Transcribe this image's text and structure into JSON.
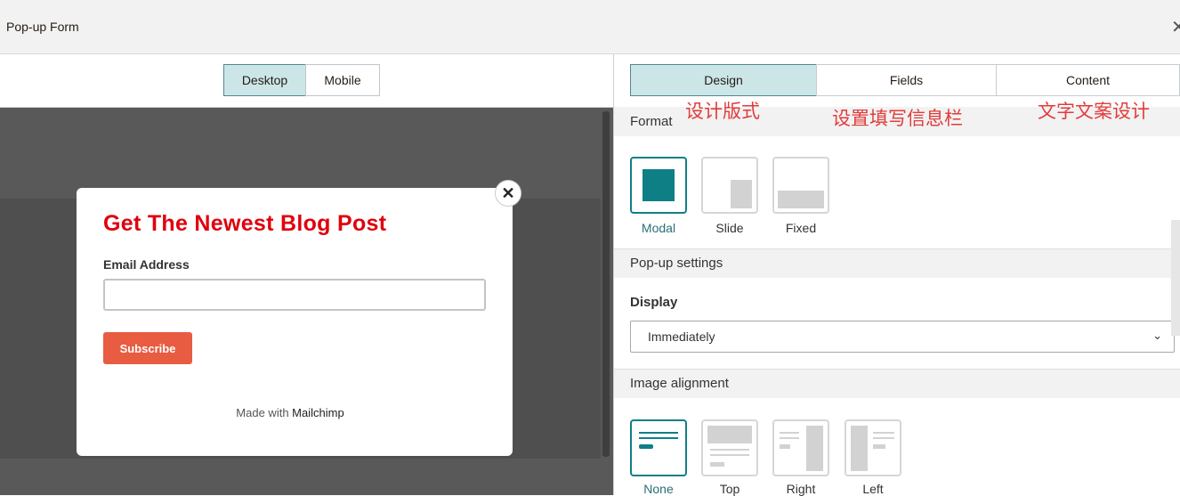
{
  "window": {
    "title": "Pop-up Form",
    "close_glyph": "✕"
  },
  "preview": {
    "device_tabs": [
      {
        "label": "Desktop",
        "active": true
      },
      {
        "label": "Mobile",
        "active": false
      }
    ],
    "popup": {
      "close_glyph": "✕",
      "heading": "Get The Newest Blog Post",
      "email_label": "Email Address",
      "email_value": "",
      "subscribe_label": "Subscribe",
      "made_with": "Made with",
      "brand": "Mailchimp"
    }
  },
  "settings": {
    "tabs": [
      {
        "label": "Design",
        "active": true
      },
      {
        "label": "Fields",
        "active": false
      },
      {
        "label": "Content",
        "active": false
      }
    ],
    "annotations": [
      "设计版式",
      "设置填写信息栏",
      "文字文案设计"
    ],
    "format": {
      "title": "Format",
      "options": [
        {
          "label": "Modal",
          "active": true
        },
        {
          "label": "Slide",
          "active": false
        },
        {
          "label": "Fixed",
          "active": false
        }
      ]
    },
    "popup_settings": {
      "title": "Pop-up settings",
      "display_label": "Display",
      "display_value": "Immediately",
      "chevron": "⌄"
    },
    "image_alignment": {
      "title": "Image alignment",
      "options": [
        {
          "label": "None",
          "active": true
        },
        {
          "label": "Top",
          "active": false
        },
        {
          "label": "Right",
          "active": false
        },
        {
          "label": "Left",
          "active": false
        }
      ]
    }
  },
  "colors": {
    "accent": "#0f7f86",
    "tab_active": "#cce6e8",
    "heading": "#e0000d",
    "button": "#e85c41",
    "annotation": "#e23b3b"
  }
}
